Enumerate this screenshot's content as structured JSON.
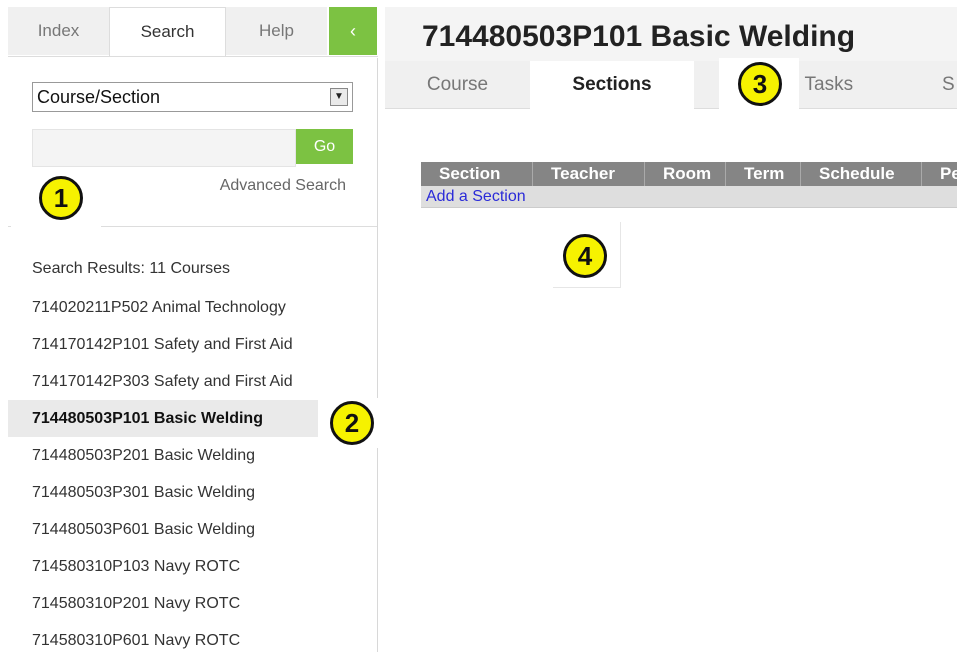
{
  "left_tabs": {
    "index": "Index",
    "search": "Search",
    "help": "Help",
    "collapse": "‹"
  },
  "search": {
    "type_value": "Course/Section",
    "dropdown_arrow": "▼",
    "input_value": "",
    "go_label": "Go",
    "advanced_label": "Advanced Search"
  },
  "results": {
    "title": "Search Results: 11 Courses",
    "items": [
      "714020211P502 Animal Technology",
      "714170142P101 Safety and First Aid",
      "714170142P303 Safety and First Aid",
      "714480503P101 Basic Welding",
      "714480503P201 Basic Welding",
      "714480503P301 Basic Welding",
      "714480503P601 Basic Welding",
      "714580310P103 Navy ROTC",
      "714580310P201 Navy ROTC",
      "714580310P601 Navy ROTC"
    ]
  },
  "main": {
    "title": "714480503P101 Basic Welding",
    "tabs": {
      "course": "Course",
      "sections": "Sections",
      "tasks": "g Tasks",
      "more": "S"
    },
    "table": {
      "headers": [
        "Section",
        "Teacher",
        "Room",
        "Term",
        "Schedule",
        "Pe"
      ],
      "add_link": "Add a Section"
    }
  },
  "callouts": [
    "1",
    "2",
    "3",
    "4"
  ],
  "colors": {
    "accent_green": "#7cc242",
    "callout_yellow": "#f6f200",
    "table_header": "#858585",
    "link_blue": "#2a2ad8"
  }
}
